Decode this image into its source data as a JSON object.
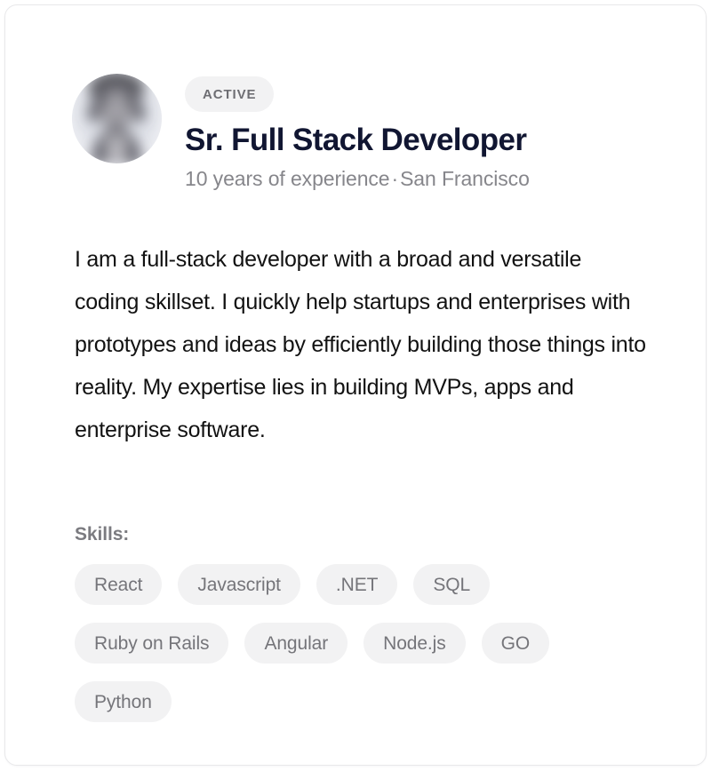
{
  "card": {
    "status_badge": "ACTIVE",
    "title": "Sr. Full Stack Developer",
    "experience": "10 years of experience",
    "separator": "·",
    "location": "San Francisco",
    "bio": "I am a full-stack developer with a broad and versatile coding skillset. I quickly help startups and enterprises with prototypes and ideas by efficiently building those things into reality. My expertise lies in building MVPs, apps and enterprise software.",
    "avatar_alt": "profile-photo-blurred",
    "skills_label": "Skills:",
    "skills": [
      "React",
      "Javascript",
      ".NET",
      "SQL",
      "Ruby on Rails",
      "Angular",
      "Node.js",
      "GO",
      "Python"
    ],
    "colors": {
      "title": "#111632",
      "meta": "#86868b",
      "body": "#121212",
      "tag_bg": "#f2f2f3",
      "tag_text": "#75757a",
      "badge_bg": "#f2f2f3",
      "badge_text": "#6e6e73",
      "card_border": "#e8e8ea"
    }
  }
}
